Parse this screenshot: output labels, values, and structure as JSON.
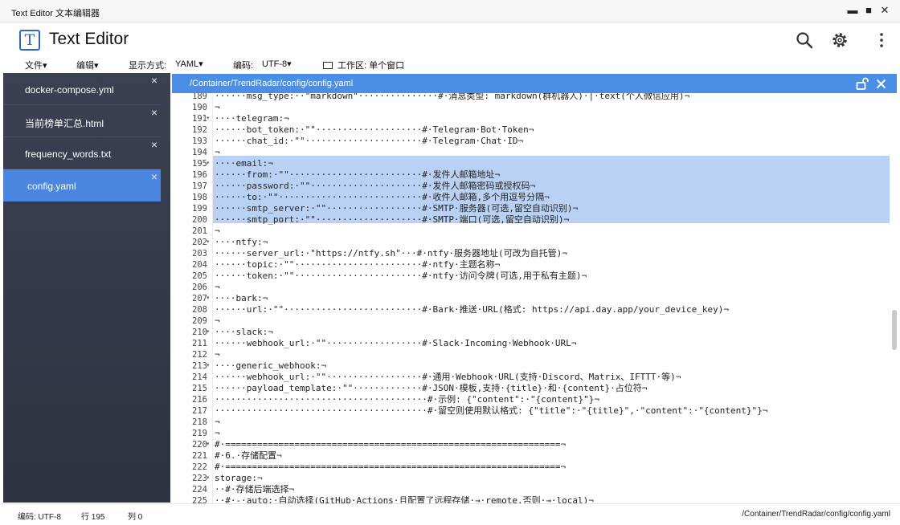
{
  "window": {
    "title": "Text Editor 文本编辑器",
    "minimize": "▬",
    "maximize": "■",
    "close": "✕"
  },
  "app": {
    "logo_letter": "T",
    "title": "Text Editor"
  },
  "menu": {
    "file": "文件",
    "edit": "编辑",
    "display_label": "显示方式:",
    "display_value": "YAML",
    "encoding_label": "编码:",
    "encoding_value": "UTF-8",
    "workspace": "工作区: 单个窗口"
  },
  "tabs": [
    {
      "name": "docker-compose.yml",
      "close": "×"
    },
    {
      "name": "当前榜单汇总.html",
      "close": "×"
    },
    {
      "name": "frequency_words.txt",
      "close": "×"
    },
    {
      "name": "config.yaml",
      "close": "×"
    }
  ],
  "pathbar": {
    "path": "/Container/TrendRadar/config/config.yaml"
  },
  "lines": [
    {
      "n": "189",
      "t": "······msg_type:··\"markdown\"···············#·消息类型: markdown(群机器人)·|·text(个人微信应用)¬"
    },
    {
      "n": "190",
      "t": "¬"
    },
    {
      "n": "191",
      "t": "····telegram:¬"
    },
    {
      "n": "192",
      "t": "······bot_token:·\"\"····················#·Telegram·Bot·Token¬"
    },
    {
      "n": "193",
      "t": "······chat_id:·\"\"······················#·Telegram·Chat·ID¬"
    },
    {
      "n": "194",
      "t": "¬"
    },
    {
      "n": "195",
      "t": "····email:¬"
    },
    {
      "n": "196",
      "t": "······from:·\"\"·························#·发件人邮箱地址¬"
    },
    {
      "n": "197",
      "t": "······password:·\"\"·····················#·发件人邮箱密码或授权码¬"
    },
    {
      "n": "198",
      "t": "······to:·\"\"···························#·收件人邮箱,多个用逗号分隔¬"
    },
    {
      "n": "199",
      "t": "······smtp_server:·\"\"··················#·SMTP·服务器(可选,留空自动识别)¬"
    },
    {
      "n": "200",
      "t": "······smtp_port:·\"\"····················#·SMTP·端口(可选,留空自动识别)¬"
    },
    {
      "n": "201",
      "t": "¬"
    },
    {
      "n": "202",
      "t": "····ntfy:¬"
    },
    {
      "n": "203",
      "t": "······server_url:·\"https://ntfy.sh\"···#·ntfy·服务器地址(可改为自托管)¬"
    },
    {
      "n": "204",
      "t": "······topic:·\"\"························#·ntfy·主题名称¬"
    },
    {
      "n": "205",
      "t": "······token:·\"\"························#·ntfy·访问令牌(可选,用于私有主题)¬"
    },
    {
      "n": "206",
      "t": "¬"
    },
    {
      "n": "207",
      "t": "····bark:¬"
    },
    {
      "n": "208",
      "t": "······url:·\"\"··························#·Bark·推送·URL(格式: https://api.day.app/your_device_key)¬"
    },
    {
      "n": "209",
      "t": "¬"
    },
    {
      "n": "210",
      "t": "····slack:¬"
    },
    {
      "n": "211",
      "t": "······webhook_url:·\"\"··················#·Slack·Incoming·Webhook·URL¬"
    },
    {
      "n": "212",
      "t": "¬"
    },
    {
      "n": "213",
      "t": "····generic_webhook:¬"
    },
    {
      "n": "214",
      "t": "······webhook_url:·\"\"··················#·通用·Webhook·URL(支持·Discord、Matrix、IFTTT·等)¬"
    },
    {
      "n": "215",
      "t": "······payload_template:·\"\"·············#·JSON·模板,支持·{title}·和·{content}·占位符¬"
    },
    {
      "n": "216",
      "t": "········································#·示例: {\"content\":·\"{content}\"}¬"
    },
    {
      "n": "217",
      "t": "········································#·留空则使用默认格式: {\"title\":·\"{title}\",·\"content\":·\"{content}\"}¬"
    },
    {
      "n": "218",
      "t": "¬"
    },
    {
      "n": "219",
      "t": "¬"
    },
    {
      "n": "220",
      "t": "#·===============================================================¬"
    },
    {
      "n": "221",
      "t": "#·6.·存储配置¬"
    },
    {
      "n": "222",
      "t": "#·===============================================================¬"
    },
    {
      "n": "223",
      "t": "storage:¬"
    },
    {
      "n": "224",
      "t": "··#·存储后端选择¬"
    },
    {
      "n": "225",
      "t": "··#·-·auto:·自动选择(GitHub·Actions·且配置了远程存储·→·remote,否则·→·local)¬"
    }
  ],
  "folds": [
    "191",
    "195",
    "202",
    "207",
    "210",
    "213",
    "220",
    "223"
  ],
  "status": {
    "encoding": "编码: UTF-8",
    "row": "行 195",
    "col": "列 0",
    "path": "/Container/TrendRadar/config/config.yaml"
  }
}
